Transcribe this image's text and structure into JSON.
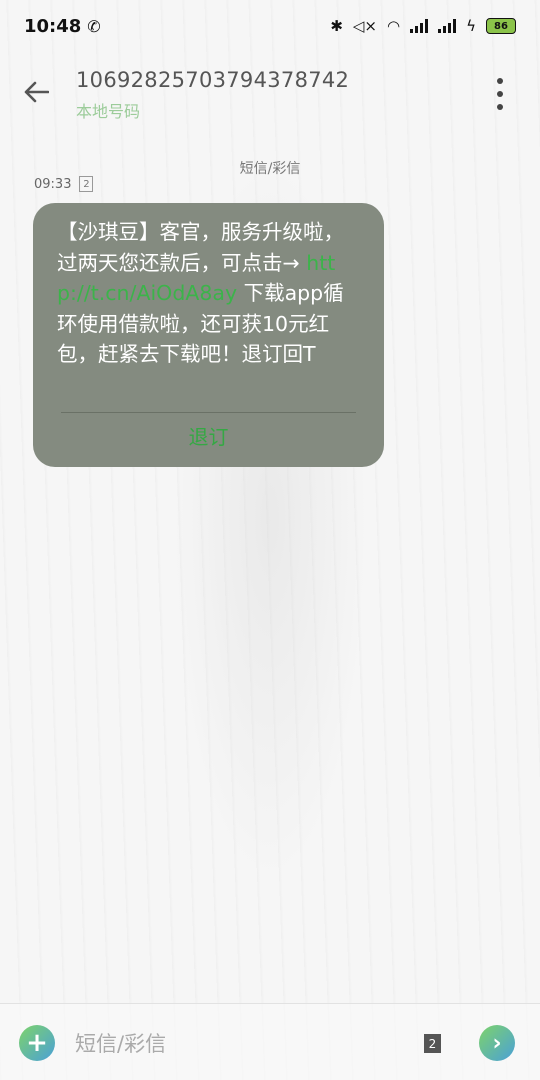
{
  "status_bar": {
    "time": "10:48",
    "call_icon": "phone-call-icon",
    "battery_level": "86",
    "icons": [
      "bluetooth-icon",
      "mute-icon",
      "wifi-icon",
      "signal-icon",
      "signal-4g-icon",
      "charging-icon",
      "battery-icon"
    ]
  },
  "header": {
    "number": "10692825703794378742",
    "subtitle": "本地号码"
  },
  "conversation": {
    "channel_label": "短信/彩信",
    "messages": [
      {
        "time": "09:33",
        "sim": "2",
        "text_before_link": "【沙琪豆】客官，服务升级啦，过两天您还款后，可点击→ ",
        "link": "http://t.cn/AiOdA8ay",
        "text_after_link": " 下载app循环使用借款啦，还可获10元红包，赶紧去下载吧！退订回T",
        "action_label": "退订"
      }
    ]
  },
  "input_bar": {
    "placeholder": "短信/彩信",
    "sim": "2",
    "send_symbol": "›",
    "add_symbol": "+"
  },
  "colors": {
    "bubble": "#848b80",
    "link": "#3cb34a",
    "subtitle": "#9ccc9a",
    "accent_green": "#7ed36a",
    "accent_blue": "#4aa0d8"
  }
}
